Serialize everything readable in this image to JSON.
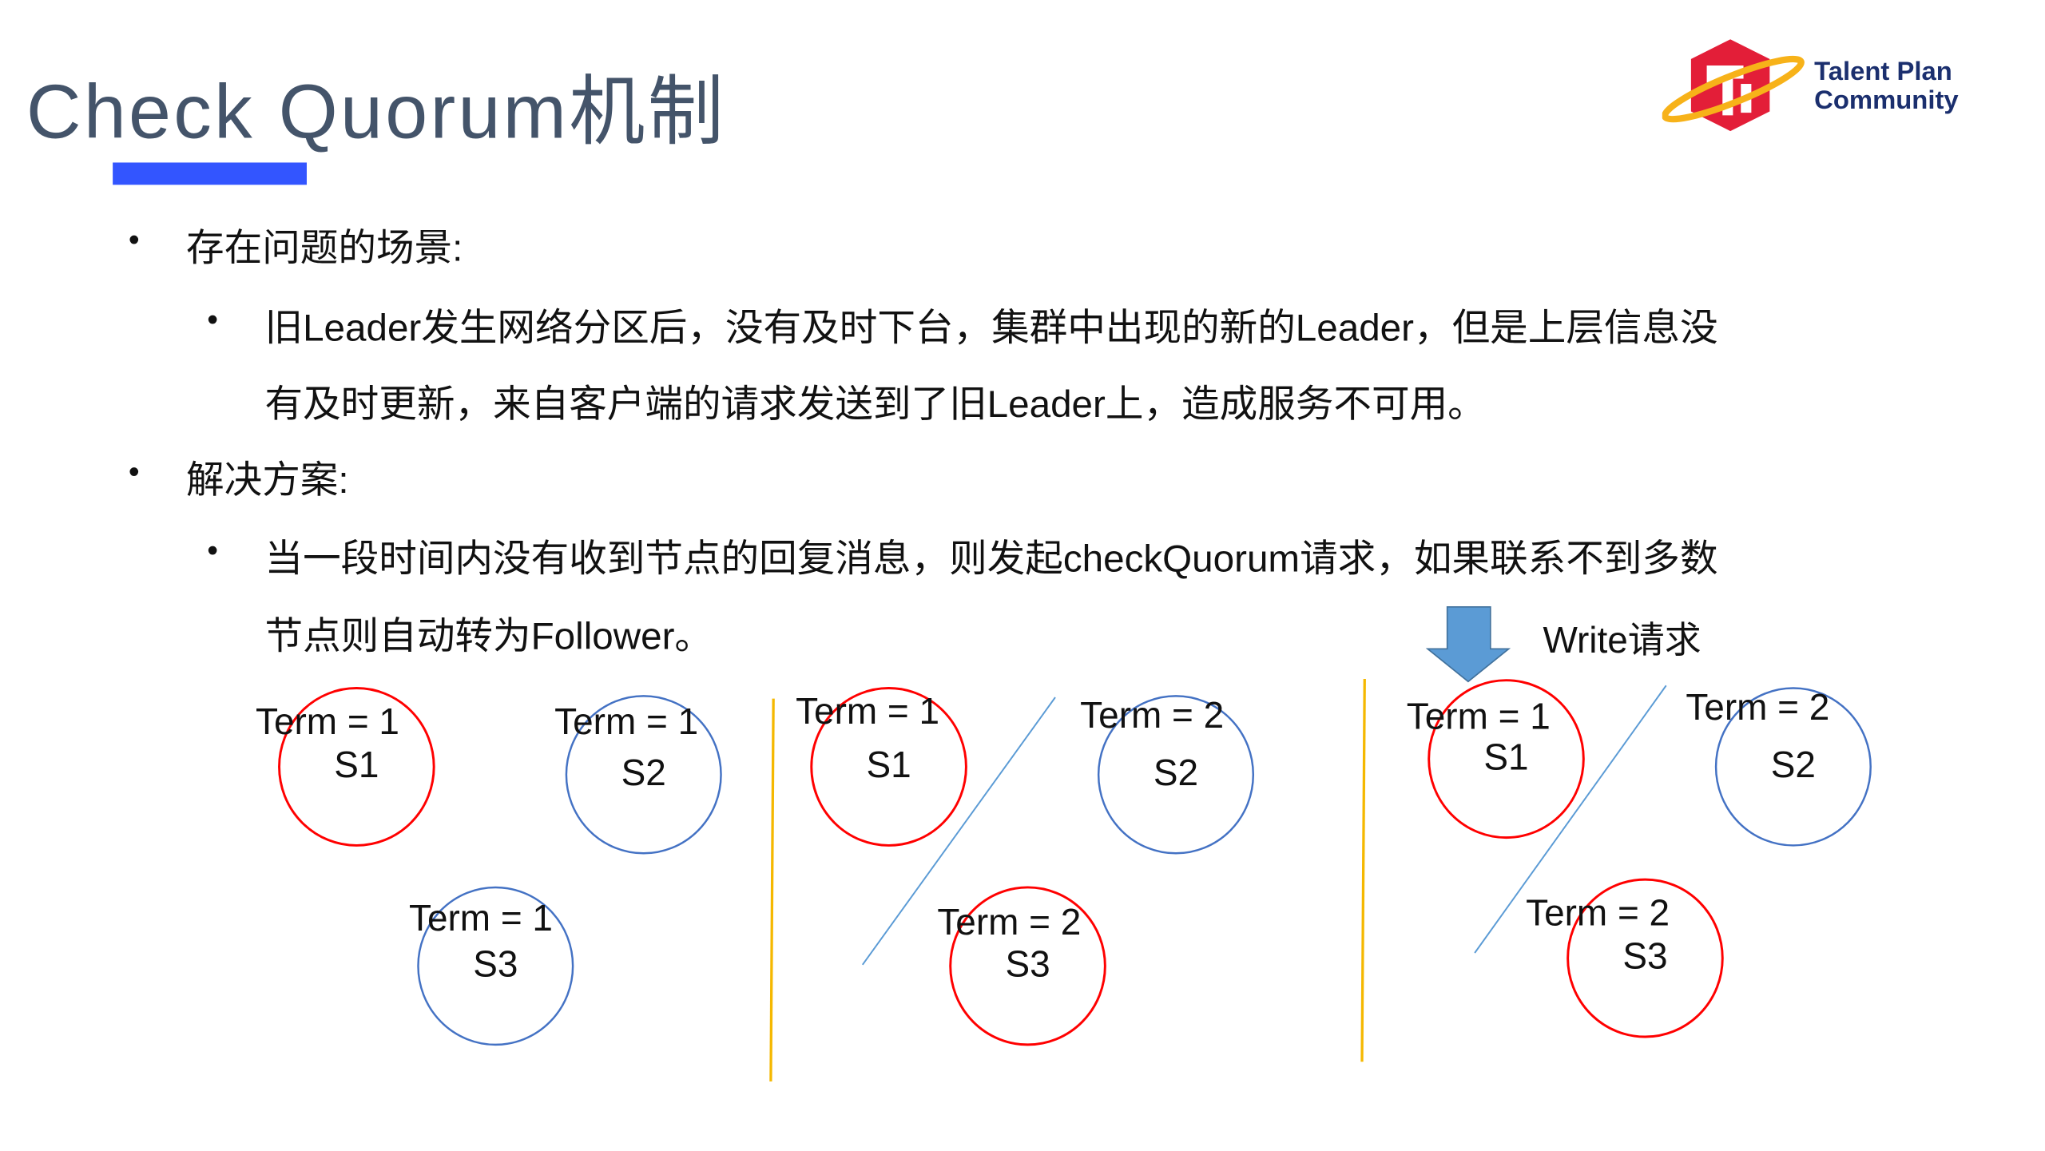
{
  "title": "Check Quorum机制",
  "logo": {
    "line1": "Talent Plan",
    "line2": "Community",
    "colors": {
      "hex": "#e31e38",
      "ring": "#f7b219",
      "text": "#1b2f6e"
    }
  },
  "bullets": [
    {
      "text": "存在问题的场景:",
      "sub": [
        "旧Leader发生网络分区后，没有及时下台，集群中出现的新的Leader，但是上层信息没",
        "有及时更新，来自客户端的请求发送到了旧Leader上，造成服务不可用。"
      ]
    },
    {
      "text": "解决方案:",
      "sub": [
        "当一段时间内没有收到节点的回复消息，则发起checkQuorum请求，如果联系不到多数",
        "节点则自动转为Follower。"
      ]
    }
  ],
  "diagram": {
    "write_label": "Write请求",
    "colors": {
      "leader": "#ff0000",
      "follower": "#4472c4",
      "divider": "#f5b800",
      "partition": "#5b9bd5",
      "arrow": "#5b9bd5"
    },
    "groups": [
      {
        "nodes": [
          {
            "name": "S1",
            "term": "Term = 1"
          },
          {
            "name": "S2",
            "term": "Term = 1"
          },
          {
            "name": "S3",
            "term": "Term = 1"
          }
        ]
      },
      {
        "nodes": [
          {
            "name": "S1",
            "term": "Term = 1"
          },
          {
            "name": "S2",
            "term": "Term = 2"
          },
          {
            "name": "S3",
            "term": "Term = 2"
          }
        ]
      },
      {
        "nodes": [
          {
            "name": "S1",
            "term": "Term = 1"
          },
          {
            "name": "S2",
            "term": "Term = 2"
          },
          {
            "name": "S3",
            "term": "Term = 2"
          }
        ]
      }
    ]
  }
}
